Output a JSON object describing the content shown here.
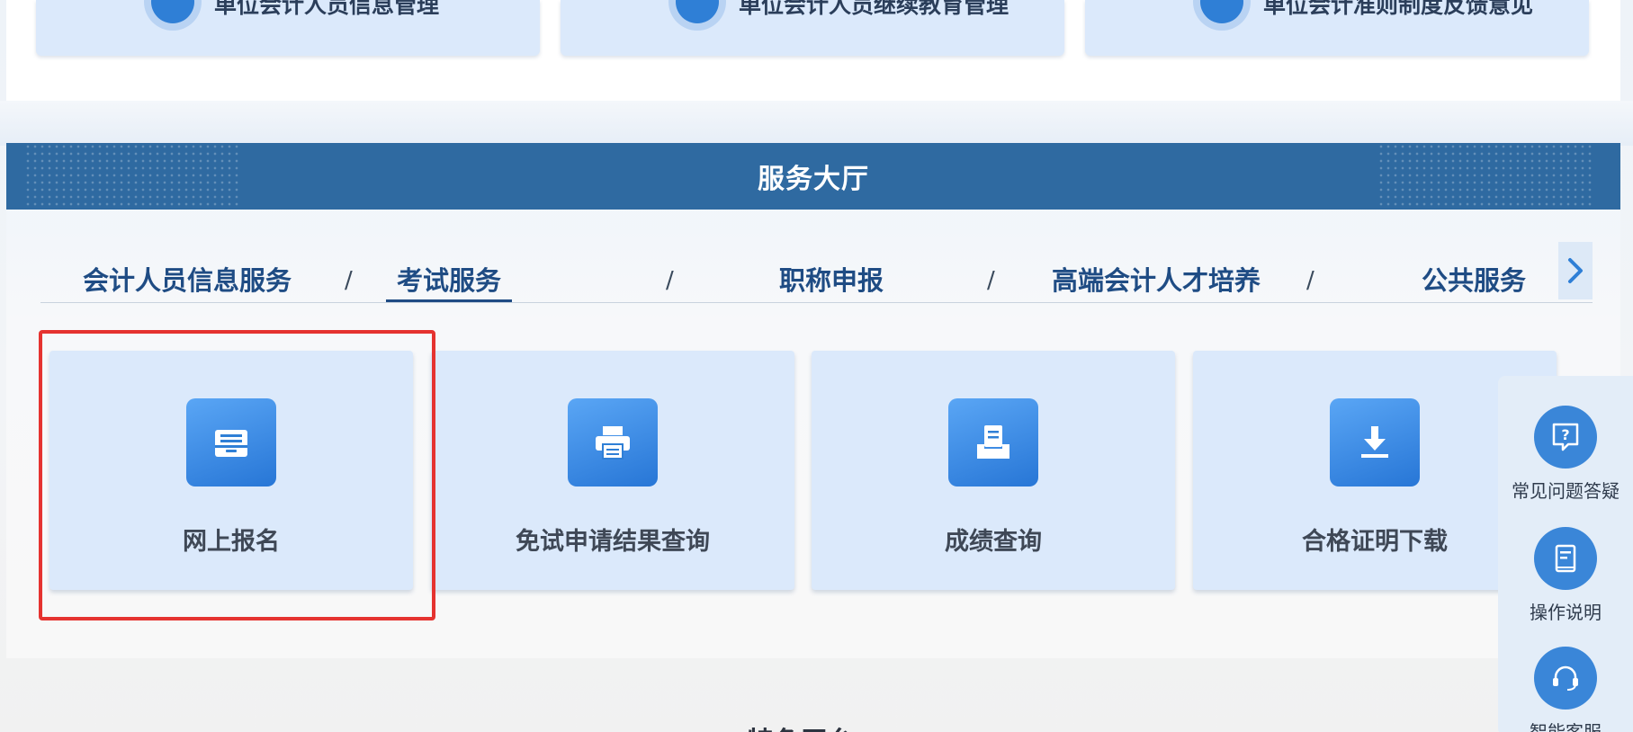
{
  "top_cards": [
    {
      "label": "单位会计人员信息管理",
      "icon": "id-card-icon"
    },
    {
      "label": "单位会计人员继续教育管理",
      "icon": "document-search-icon"
    },
    {
      "label": "单位会计准则制度反馈意见",
      "icon": "chat-bubble-icon"
    }
  ],
  "hall": {
    "title": "服务大厅",
    "tabs": [
      {
        "label": "会计人员信息服务"
      },
      {
        "label": "考试服务",
        "active": true
      },
      {
        "label": "职称申报"
      },
      {
        "label": "高端会计人才培养"
      },
      {
        "label": "公共服务"
      }
    ],
    "tab_separator": "/",
    "services": [
      {
        "label": "网上报名",
        "icon": "inbox-tray-icon",
        "selected": true
      },
      {
        "label": "免试申请结果查询",
        "icon": "printer-icon"
      },
      {
        "label": "成绩查询",
        "icon": "document-tray-icon"
      },
      {
        "label": "合格证明下载",
        "icon": "download-icon"
      }
    ]
  },
  "float_bar": [
    {
      "label": "常见问题答疑",
      "icon": "question-bubble-icon"
    },
    {
      "label": "操作说明",
      "icon": "manual-book-icon"
    },
    {
      "label": "智能客服",
      "icon": "headset-icon"
    }
  ],
  "next_section_title": "特色平台",
  "colors": {
    "header_blue": "#2f6aa1",
    "tab_text": "#1f4c84",
    "card_bg": "#dbe9fb",
    "icon_blue": "#2776d6",
    "selection_red": "#e53330"
  }
}
